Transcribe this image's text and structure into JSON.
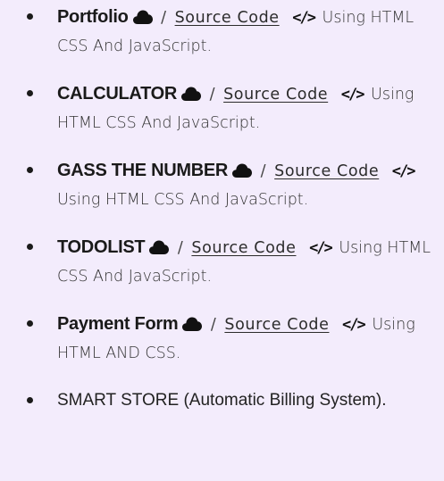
{
  "projects": [
    {
      "title": "Portfolio",
      "separator": "/",
      "link_label": "Source Code",
      "code_icon": "</>",
      "description": "Using HTML CSS And JavaScript."
    },
    {
      "title": "CALCULATOR",
      "separator": "/",
      "link_label": "Source Code",
      "code_icon": "</>",
      "description": "Using HTML CSS And JavaScript."
    },
    {
      "title": "GASS THE NUMBER",
      "separator": "/",
      "link_label": "Source Code",
      "code_icon": "</>",
      "description": "Using HTML CSS And JavaScript."
    },
    {
      "title": "TODOLIST",
      "separator": "/",
      "link_label": "Source Code",
      "code_icon": "</>",
      "description": "Using HTML CSS And JavaScript."
    },
    {
      "title": "Payment Form",
      "separator": "/",
      "link_label": "Source Code",
      "code_icon": "</>",
      "description": "Using HTML AND CSS."
    }
  ],
  "last_item": "SMART STORE (Automatic Billing System).",
  "icons": {
    "cloud": "cloud-icon",
    "code": "code-icon",
    "bullet": "bullet-icon"
  },
  "colors": {
    "background": "#f3ecfc",
    "text": "#1a1a1a"
  }
}
